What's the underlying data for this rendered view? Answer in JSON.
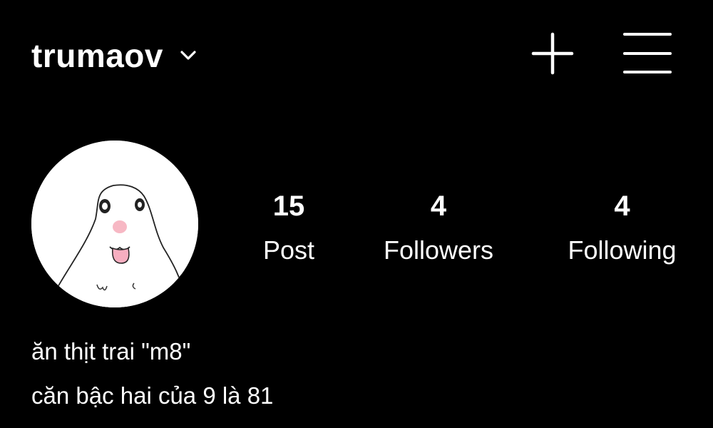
{
  "header": {
    "username": "trumaov",
    "account_switcher_icon": "chevron-down-icon",
    "create_icon": "plus-icon",
    "menu_icon": "hamburger-menu-icon"
  },
  "profile": {
    "avatar": "cartoon-hamster-sticking-out-tongue",
    "stats": {
      "posts": {
        "value": "15",
        "label": "Post"
      },
      "followers": {
        "value": "4",
        "label": "Followers"
      },
      "following": {
        "value": "4",
        "label": "Following"
      }
    },
    "bio": [
      "ăn thịt trai \"m8\"",
      "căn bậc hai của 9 là 81"
    ]
  },
  "colors": {
    "background": "#000000",
    "text": "#ffffff",
    "avatar_nose": "#f7b8c4",
    "avatar_tongue": "#f7aec0"
  }
}
